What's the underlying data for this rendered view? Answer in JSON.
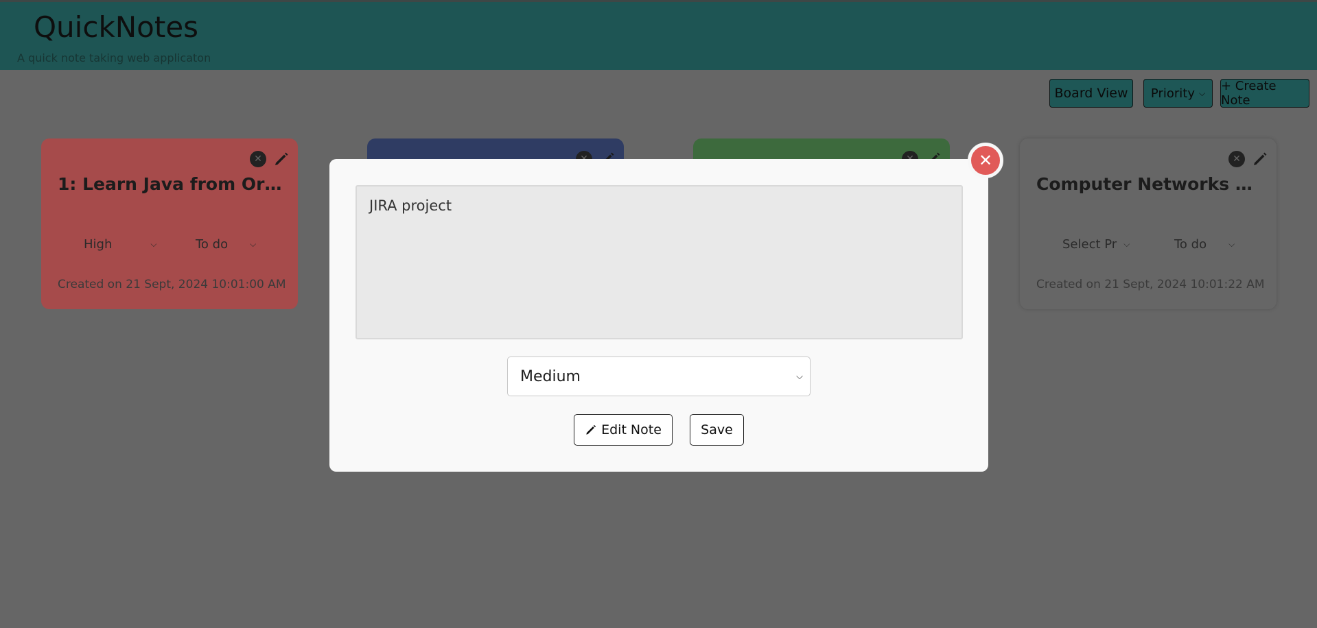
{
  "app": {
    "title": "QuickNotes",
    "subtitle": "A quick note taking web applicaton"
  },
  "toolbar": {
    "board_view": "Board View",
    "priority_filter": "Priority",
    "create_note": "+ Create Note"
  },
  "cards": [
    {
      "title": "1: Learn Java from Oracle",
      "priority": "High",
      "status": "To do",
      "created": "Created on 21 Sept, 2024 10:01:00 AM",
      "color": "#a64b4b"
    },
    {
      "title": "",
      "color": "#2f3c63"
    },
    {
      "title": "",
      "color": "#3d6a3d"
    },
    {
      "title": "Computer Networks Playlist",
      "priority": "Select Pr",
      "status": "To do",
      "created": "Created on 21 Sept, 2024 10:01:22 AM",
      "color": "#666666"
    }
  ],
  "modal": {
    "note_text": "JIRA project",
    "priority_value": "Medium",
    "edit_label": "Edit Note",
    "save_label": "Save"
  },
  "icons": {
    "close": "close-icon",
    "edit": "pencil-icon"
  },
  "colors": {
    "accent": "#1e5554",
    "close": "#e15a58"
  }
}
